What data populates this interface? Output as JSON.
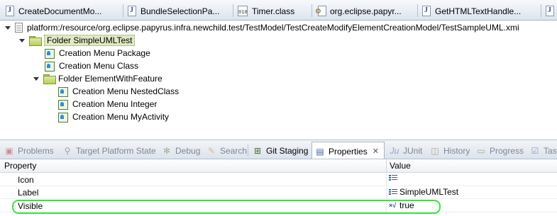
{
  "colors": {
    "highlight": "#35e63a",
    "selection": "#dfe9c4",
    "tabstrip": "#dde4ee"
  },
  "editor_tabs": [
    {
      "label": "CreateDocumentMo...",
      "icon": "java-file-icon"
    },
    {
      "label": "BundleSelectionPa...",
      "icon": "java-file-icon"
    },
    {
      "label": "Timer.class",
      "icon": "class-file-icon"
    },
    {
      "label": "org.eclipse.papyr...",
      "icon": "manifest-file-icon"
    },
    {
      "label": "GetHTMLTextHandle...",
      "icon": "java-file-icon"
    }
  ],
  "tree": {
    "root": "platform:/resource/org.eclipse.papyrus.infra.newchild.test/TestModel/TestCreateModifyElementCreationModel/TestSampleUML.xmi",
    "folder1": "Folder SimpleUMLTest",
    "item_package": "Creation Menu Package",
    "item_class": "Creation Menu Class",
    "folder2": "Folder ElementWithFeature",
    "item_nested": "Creation Menu NestedClass",
    "item_integer": "Creation Menu Integer",
    "item_activity": "Creation Menu MyActivity"
  },
  "view_tabs": {
    "problems": "Problems",
    "target": "Target Platform State",
    "debug": "Debug",
    "search": "Search",
    "git": "Git Staging",
    "properties": "Properties",
    "close": "✕",
    "junit": "JUnit",
    "history": "History",
    "progress": "Progress",
    "tasks": "Task"
  },
  "properties": {
    "header_property": "Property",
    "header_value": "Value",
    "rows": [
      {
        "name": "Icon",
        "value": ""
      },
      {
        "name": "Label",
        "value": "SimpleUMLTest"
      },
      {
        "name": "Visible",
        "value": "true"
      }
    ]
  }
}
